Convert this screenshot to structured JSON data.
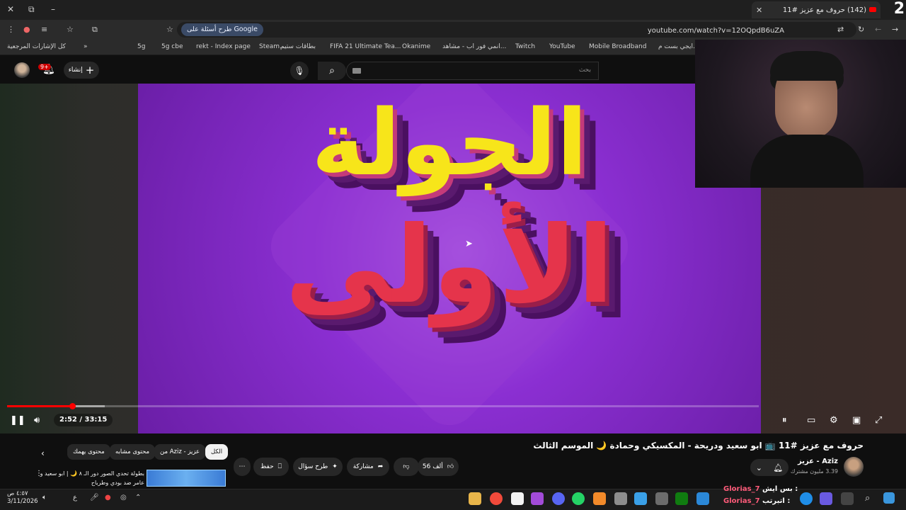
{
  "browser": {
    "tab_title": "(142) حروف مع عزيز #11",
    "tab_count": "2",
    "new_tab_label": "+",
    "url": "youtube.com/watch?v=12OQpdB6uZA",
    "ask_google": "طرح أسئلة على Google",
    "window_controls": {
      "minimize": "–",
      "restore": "⧉"
    },
    "bookmarks": [
      "كل الإشارات المرجعية",
      "5g",
      "5g cbe",
      "rekt - Index page",
      "Steam...",
      "بطاقات ستيم",
      "FIFA 21 Ultimate Tea...",
      "Okanime",
      "انمي فور اب - مشاهد...",
      "Twitch",
      "YouTube",
      "Mobile Broadband",
      "ايجي بست م..."
    ],
    "bookmarks_more": "»"
  },
  "youtube": {
    "notif_count": "9+",
    "create_label": "إنشاء",
    "search_placeholder": "بحث"
  },
  "video": {
    "title_line1": "الجولة",
    "title_line2": "الأولى",
    "time": "2:52 / 33:15",
    "progress_fraction": 0.087,
    "buffered_fraction": 0.13
  },
  "meta": {
    "title": "حروف مع عزيز #11 📺 ابو سعيد ودريحة - المكسيكي وحمادة 🌙 الموسم الثالث",
    "channel_name": "Aziz - عزيز",
    "subscribers": "3.39 مليون مشترك",
    "like_count": "56 ألف",
    "share_label": "مشاركة",
    "ask_label": "طرح سؤال",
    "save_label": "حفظ",
    "more_label": "⋯"
  },
  "chips": [
    {
      "label": "الكل",
      "active": true
    },
    {
      "label": "من Aziz - عزيز",
      "active": false
    },
    {
      "label": "محتوى مشابه",
      "active": false
    },
    {
      "label": "محتوى يهمك",
      "active": false
    }
  ],
  "recommendation": {
    "title": "بطولة تحدي الصور دور الـ ٨ 🌙 | ابو سعيد و عامر ضد بودي وطرباح"
  },
  "taskbar": {
    "time": "٤:٥٧ ص",
    "date": "3/11/2026",
    "lang": "ع"
  },
  "chat": [
    {
      "user": "Glorias_7",
      "msg": "بس ايش :"
    },
    {
      "user": "Glorias_7",
      "msg": "اتبرتب :"
    }
  ],
  "colors": {
    "accent": "#ff0000",
    "title_yellow": "#f7e51a",
    "title_red": "#e5344b",
    "purple_bg": "#8b2fd2",
    "chat_user": "#ff5b7a"
  }
}
